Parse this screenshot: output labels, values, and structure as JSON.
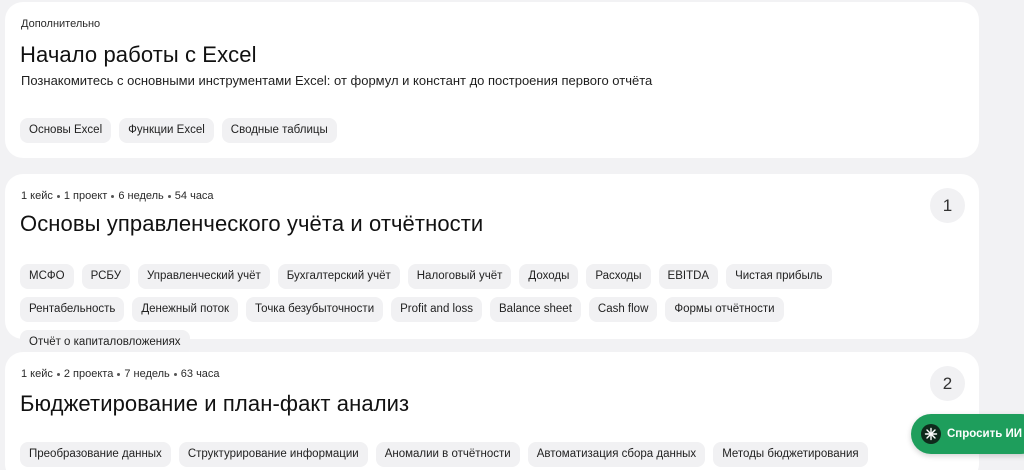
{
  "cards": [
    {
      "eyebrow": "Дополнительно",
      "title": "Начало работы с Excel",
      "subtitle": "Познакомитесь с основными инструментами Excel: от формул и констант до построения первого отчёта",
      "tags": [
        "Основы Excel",
        "Функции Excel",
        "Сводные таблицы"
      ]
    },
    {
      "meta": [
        "1 кейс",
        "1 проект",
        "6 недель",
        "54 часа"
      ],
      "title": "Основы управленческого учёта и отчётности",
      "number": "1",
      "tags": [
        "МСФО",
        "РСБУ",
        "Управленческий учёт",
        "Бухгалтерский учёт",
        "Налоговый учёт",
        "Доходы",
        "Расходы",
        "EBITDA",
        "Чистая прибыль",
        "Рентабельность",
        "Денежный поток",
        "Точка безубыточности",
        "Profit and loss",
        "Balance sheet",
        "Cash flow",
        "Формы отчётности",
        "Отчёт о капиталовложениях"
      ]
    },
    {
      "meta": [
        "1 кейс",
        "2 проекта",
        "7 недель",
        "63 часа"
      ],
      "title": "Бюджетирование и план-факт анализ",
      "number": "2",
      "tags": [
        "Преобразование данных",
        "Структурирование информации",
        "Аномалии в отчётности",
        "Автоматизация сбора данных",
        "Методы бюджетирования"
      ]
    }
  ],
  "ask_ai": {
    "label": "Спросить ИИ",
    "icon": "sparkle-icon",
    "color": "#1e9e5c"
  }
}
